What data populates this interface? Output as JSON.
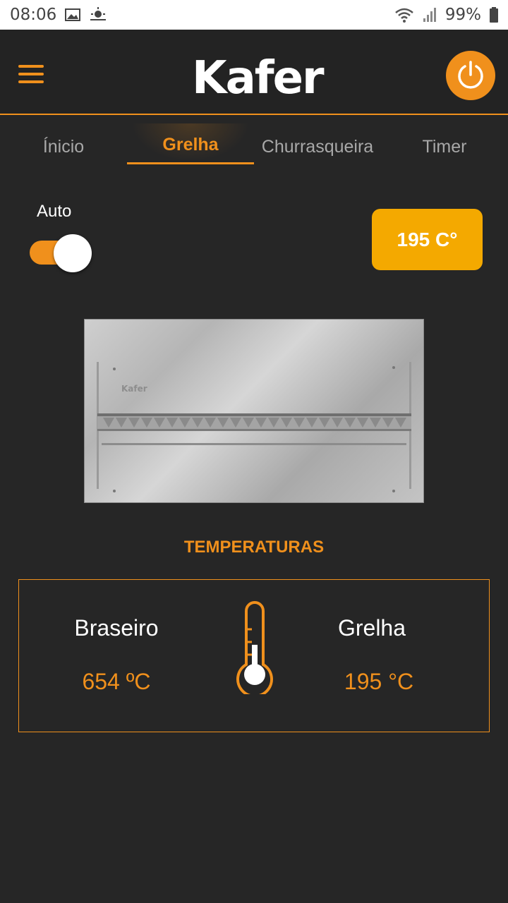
{
  "status_bar": {
    "time": "08:06",
    "battery": "99%"
  },
  "header": {
    "logo_text": "Kafer",
    "menu_icon": "hamburger-icon",
    "power_icon": "power-icon"
  },
  "tabs": [
    {
      "label": "Ínicio",
      "active": false
    },
    {
      "label": "Grelha",
      "active": true
    },
    {
      "label": "Churrasqueira",
      "active": false
    },
    {
      "label": "Timer",
      "active": false
    }
  ],
  "auto": {
    "label": "Auto",
    "enabled": true
  },
  "temp_badge": "195 C°",
  "section_title": "TEMPERATURAS",
  "temperatures": {
    "braseiro": {
      "label": "Braseiro",
      "value": "654 ºC"
    },
    "grelha": {
      "label": "Grelha",
      "value": "195 °C"
    }
  },
  "colors": {
    "accent": "#f0901c",
    "badge": "#f4a900",
    "background": "#262626"
  }
}
